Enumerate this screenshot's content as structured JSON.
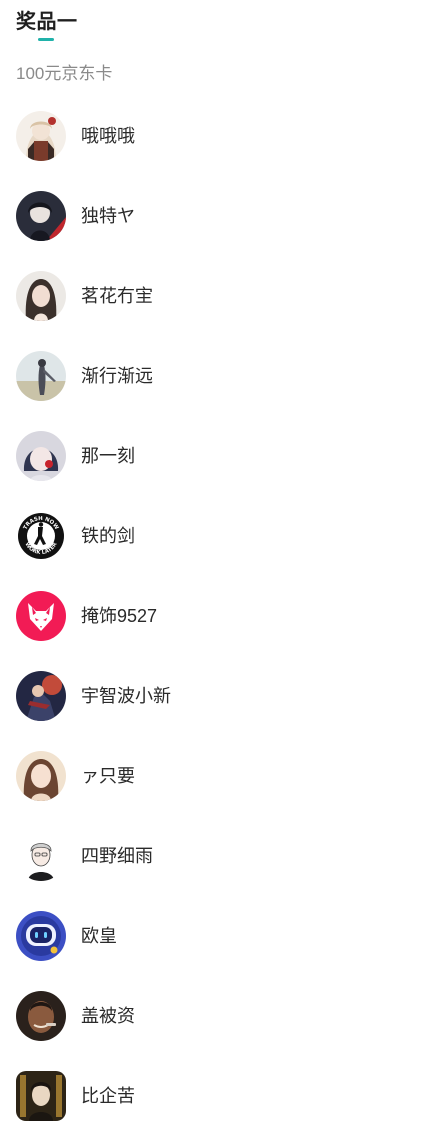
{
  "section": {
    "title": "奖品一",
    "prize_name": "100元京东卡"
  },
  "winners": [
    {
      "name": "哦哦哦"
    },
    {
      "name": "独特ヤ"
    },
    {
      "name": "茗花冇宔"
    },
    {
      "name": "渐行渐远"
    },
    {
      "name": "那一刻"
    },
    {
      "name": "铁的剑"
    },
    {
      "name": "掩饰9527"
    },
    {
      "name": "宇智波小新"
    },
    {
      "name": "ァ只要"
    },
    {
      "name": "四野细雨"
    },
    {
      "name": "欧皇"
    },
    {
      "name": "盖被资"
    },
    {
      "name": "比企苦"
    }
  ],
  "avatar_badge_text": {
    "line1": "TRASH NOW",
    "line2": "WORK LATER"
  },
  "colors": {
    "accent": "#20b2aa",
    "title": "#1f1f1f",
    "subtitle": "#8a8a8a",
    "name": "#2a2a2a"
  }
}
